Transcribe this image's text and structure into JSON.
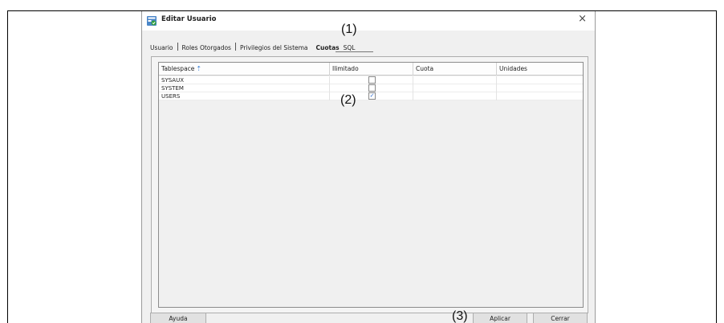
{
  "dialog": {
    "title": "Editar Usuario",
    "close_glyph": "×"
  },
  "tabs": [
    {
      "label": "Usuario"
    },
    {
      "label": "Roles Otorgados"
    },
    {
      "label": "Privilegios del Sistema"
    },
    {
      "label": "Cuotas",
      "active": true
    },
    {
      "label": "SQL"
    }
  ],
  "annotations": {
    "a1": "(1)",
    "a2": "(2)",
    "a3": "(3)"
  },
  "table": {
    "columns": [
      "Tablespace",
      "Ilimitado",
      "Cuota",
      "Unidades"
    ],
    "sort_icon": "sort-ascending-icon",
    "rows": [
      {
        "tablespace": "SYSAUX",
        "unlimited": false,
        "quota": "",
        "units": ""
      },
      {
        "tablespace": "SYSTEM",
        "unlimited": false,
        "quota": "",
        "units": ""
      },
      {
        "tablespace": "USERS",
        "unlimited": true,
        "quota": "",
        "units": ""
      }
    ]
  },
  "buttons": {
    "help": "Ayuda",
    "apply": "Aplicar",
    "close": "Cerrar"
  },
  "colors": {
    "accent": "#2f7ad6",
    "dialog_bg": "#f0f0f0"
  }
}
